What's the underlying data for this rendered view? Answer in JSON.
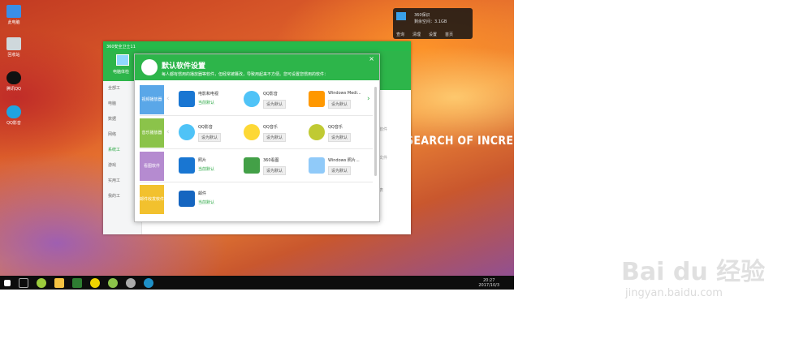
{
  "desktop": {
    "icons": [
      "此电脑",
      "回收站",
      "腾讯QQ",
      "QQ影音"
    ],
    "promo": "SEARCH OF INCREDIBLE"
  },
  "widget": {
    "title": "360保识",
    "line": "剩余空间：3.1GB",
    "menu": [
      "查询",
      "清理",
      "设置",
      "首页"
    ]
  },
  "taskbar": {
    "time": "20:27",
    "date": "2017/10/3"
  },
  "window": {
    "title": "360安全卫士11",
    "side_top": "电脑体检",
    "side": [
      "全部工",
      "电脑",
      "数据",
      "网络",
      "系统工",
      "游戏",
      "实用工",
      "我的工"
    ],
    "right_texts": [
      "软件",
      "文件",
      "表"
    ]
  },
  "dialog": {
    "title": "默认软件设置",
    "subtitle": "每人都有惯用的播放器等软件，但经常被篡改，导致用起来不方便。您可设置您惯用的软件：",
    "rows": [
      {
        "cat": "视频播放器",
        "items": [
          {
            "name": "电影和电视",
            "status": "当前默认"
          },
          {
            "name": "QQ影音",
            "status": "设为默认"
          },
          {
            "name": "Windows Medi...",
            "status": "设为默认"
          }
        ]
      },
      {
        "cat": "音乐播放器",
        "items": [
          {
            "name": "QQ影音",
            "status": "设为默认"
          },
          {
            "name": "QQ音乐",
            "status": "设为默认"
          },
          {
            "name": "QQ音乐",
            "status": "设为默认"
          }
        ]
      },
      {
        "cat": "看图软件",
        "items": [
          {
            "name": "照片",
            "status": "当前默认"
          },
          {
            "name": "360看图",
            "status": "设为默认"
          },
          {
            "name": "Windows 照片...",
            "status": "设为默认"
          }
        ]
      },
      {
        "cat": "邮件收发软件",
        "items": [
          {
            "name": "邮件",
            "status": "当前默认"
          }
        ]
      }
    ]
  },
  "watermark": {
    "logo": "Bai du 经验",
    "url": "jingyan.baidu.com"
  },
  "colors": {
    "green": "#2db54a",
    "video": "#5aa7e8",
    "music": "#8bc34a",
    "image": "#b58bd0",
    "mail": "#f2c12e"
  }
}
